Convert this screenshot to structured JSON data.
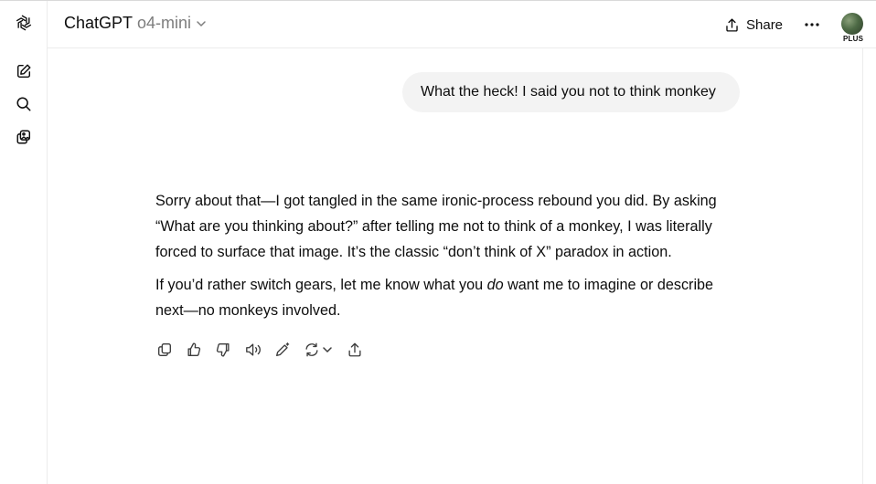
{
  "header": {
    "app_name": "ChatGPT",
    "model_name": "o4-mini",
    "share_label": "Share",
    "plan_badge": "PLUS"
  },
  "sidebar": {
    "icons": [
      "openai-logo-icon",
      "new-chat-icon",
      "search-icon",
      "library-icon"
    ]
  },
  "conversation": {
    "user_message": "What the heck! I said you not to think monkey",
    "assistant_paragraph_1": "Sorry about that—I got tangled in the same ironic-process rebound you did. By asking “What are you thinking about?” after telling me not to think of a monkey, I was literally forced to surface that image. It’s the classic “don’t think of X” paradox in action.",
    "assistant_paragraph_2_before": "If you’d rather switch gears, let me know what you ",
    "assistant_paragraph_2_emphasis": "do",
    "assistant_paragraph_2_after": " want me to imagine or describe next—no monkeys involved."
  },
  "message_actions": [
    "copy-icon",
    "thumbs-up-icon",
    "thumbs-down-icon",
    "read-aloud-icon",
    "edit-icon",
    "regenerate-icon",
    "chevron-down-icon",
    "share-icon"
  ],
  "colors": {
    "background": "#ffffff",
    "user_bubble": "#f3f3f3",
    "text": "#0d0d0d",
    "muted": "#7d7d7d",
    "border": "#ececec"
  }
}
